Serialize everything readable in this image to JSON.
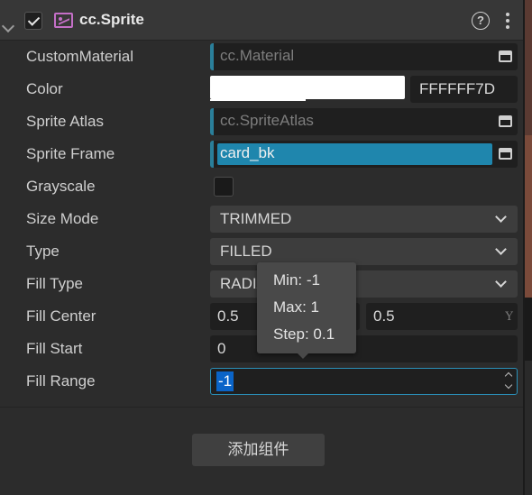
{
  "component": {
    "title": "cc.Sprite",
    "enabled": true,
    "help_label": "?"
  },
  "properties": {
    "custom_material": {
      "label": "CustomMaterial",
      "placeholder": "cc.Material"
    },
    "color": {
      "label": "Color",
      "hex": "FFFFFF7D",
      "swatch": "#ffffff"
    },
    "sprite_atlas": {
      "label": "Sprite Atlas",
      "placeholder": "cc.SpriteAtlas"
    },
    "sprite_frame": {
      "label": "Sprite Frame",
      "value": "card_bk"
    },
    "grayscale": {
      "label": "Grayscale",
      "checked": false
    },
    "size_mode": {
      "label": "Size Mode",
      "value": "TRIMMED"
    },
    "type": {
      "label": "Type",
      "value": "FILLED"
    },
    "fill_type": {
      "label": "Fill Type",
      "value": "RADIAL"
    },
    "fill_center": {
      "label": "Fill Center",
      "x": "0.5",
      "y": "0.5",
      "y_axis": "Y"
    },
    "fill_start": {
      "label": "Fill Start",
      "value": "0"
    },
    "fill_range": {
      "label": "Fill Range",
      "value": "-1"
    }
  },
  "tooltip": {
    "min": "Min: -1",
    "max": "Max: 1",
    "step": "Step: 0.1"
  },
  "add_component_label": "添加组件",
  "colors": {
    "accent": "#2a7f9a",
    "selection": "#1f86ad",
    "text_selection": "#0a64c8"
  }
}
